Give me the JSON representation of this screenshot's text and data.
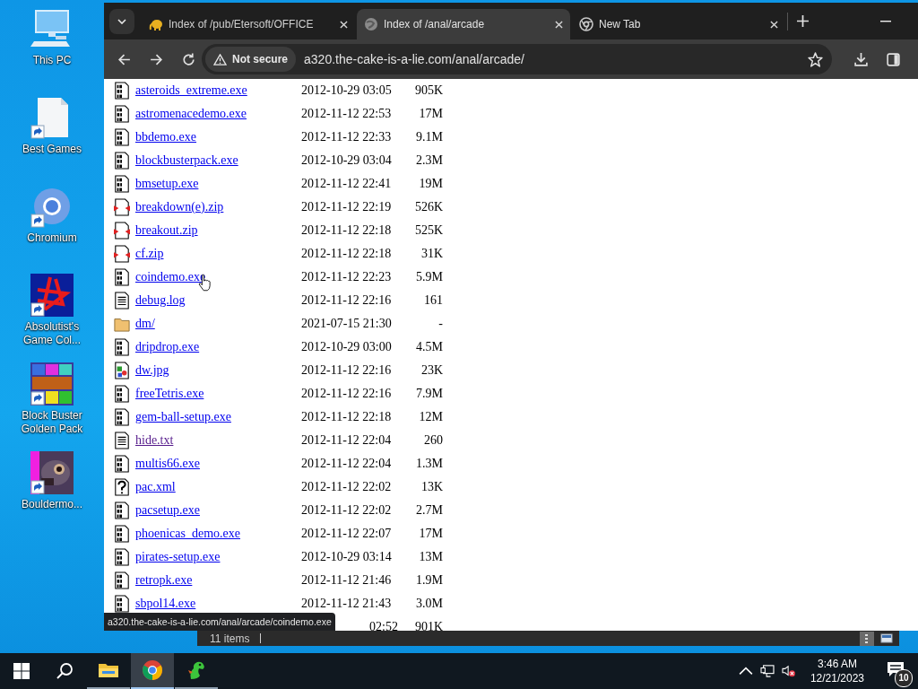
{
  "desktop": {
    "icons": [
      {
        "label": "This PC",
        "kind": "pc",
        "shortcut": false
      },
      {
        "label": "Best Games",
        "kind": "document",
        "shortcut": true
      },
      {
        "label": "Chromium",
        "kind": "chromium",
        "shortcut": true
      },
      {
        "label": "Absolutist's Game Col...",
        "kind": "star",
        "shortcut": true
      },
      {
        "label": "Block Buster Golden Pack",
        "kind": "blocks",
        "shortcut": true
      },
      {
        "label": "Bouldermo...",
        "kind": "creature",
        "shortcut": true
      }
    ]
  },
  "browser": {
    "tabs": [
      {
        "title": "Index of /pub/Etersoft/OFFICE",
        "kind": "elephant",
        "selected": false
      },
      {
        "title": "Index of /anal/arcade",
        "kind": "globe",
        "selected": true
      },
      {
        "title": "New Tab",
        "kind": "chrome",
        "selected": false
      }
    ],
    "address": {
      "security": "Not secure",
      "url": "a320.the-cake-is-a-lie.com/anal/arcade/"
    },
    "listing": {
      "rows": [
        {
          "name": "asteroids_extreme.exe",
          "date": "2012-10-29 03:05",
          "size": "905K",
          "kind": "exe",
          "visited": false,
          "hovered": false
        },
        {
          "name": "astromenacedemo.exe",
          "date": "2012-11-12 22:53",
          "size": "17M",
          "kind": "exe",
          "visited": false,
          "hovered": false
        },
        {
          "name": "bbdemo.exe",
          "date": "2012-11-12 22:33",
          "size": "9.1M",
          "kind": "exe",
          "visited": false,
          "hovered": false
        },
        {
          "name": "blockbusterpack.exe",
          "date": "2012-10-29 03:04",
          "size": "2.3M",
          "kind": "exe",
          "visited": false,
          "hovered": false
        },
        {
          "name": "bmsetup.exe",
          "date": "2012-11-12 22:41",
          "size": "19M",
          "kind": "exe",
          "visited": false,
          "hovered": false
        },
        {
          "name": "breakdown(e).zip",
          "date": "2012-11-12 22:19",
          "size": "526K",
          "kind": "zip",
          "visited": false,
          "hovered": false
        },
        {
          "name": "breakout.zip",
          "date": "2012-11-12 22:18",
          "size": "525K",
          "kind": "zip",
          "visited": false,
          "hovered": false
        },
        {
          "name": "cf.zip",
          "date": "2012-11-12 22:18",
          "size": "31K",
          "kind": "zip",
          "visited": false,
          "hovered": false
        },
        {
          "name": "coindemo.exe",
          "date": "2012-11-12 22:23",
          "size": "5.9M",
          "kind": "exe",
          "visited": false,
          "hovered": true
        },
        {
          "name": "debug.log",
          "date": "2012-11-12 22:16",
          "size": "161",
          "kind": "text",
          "visited": false,
          "hovered": false
        },
        {
          "name": "dm/",
          "date": "2021-07-15 21:30",
          "size": "-",
          "kind": "folder",
          "visited": false,
          "hovered": false
        },
        {
          "name": "dripdrop.exe",
          "date": "2012-10-29 03:00",
          "size": "4.5M",
          "kind": "exe",
          "visited": false,
          "hovered": false
        },
        {
          "name": "dw.jpg",
          "date": "2012-11-12 22:16",
          "size": "23K",
          "kind": "image",
          "visited": false,
          "hovered": false
        },
        {
          "name": "freeTetris.exe",
          "date": "2012-11-12 22:16",
          "size": "7.9M",
          "kind": "exe",
          "visited": false,
          "hovered": false
        },
        {
          "name": "gem-ball-setup.exe",
          "date": "2012-11-12 22:18",
          "size": "12M",
          "kind": "exe",
          "visited": false,
          "hovered": false
        },
        {
          "name": "hide.txt",
          "date": "2012-11-12 22:04",
          "size": "260",
          "kind": "text",
          "visited": true,
          "hovered": false
        },
        {
          "name": "multis66.exe",
          "date": "2012-11-12 22:04",
          "size": "1.3M",
          "kind": "exe",
          "visited": false,
          "hovered": false
        },
        {
          "name": "pac.xml",
          "date": "2012-11-12 22:02",
          "size": "13K",
          "kind": "unknown",
          "visited": false,
          "hovered": false
        },
        {
          "name": "pacsetup.exe",
          "date": "2012-11-12 22:02",
          "size": "2.7M",
          "kind": "exe",
          "visited": false,
          "hovered": false
        },
        {
          "name": "phoenicas_demo.exe",
          "date": "2012-11-12 22:07",
          "size": "17M",
          "kind": "exe",
          "visited": false,
          "hovered": false
        },
        {
          "name": "pirates-setup.exe",
          "date": "2012-10-29 03:14",
          "size": "13M",
          "kind": "exe",
          "visited": false,
          "hovered": false
        },
        {
          "name": "retropk.exe",
          "date": "2012-11-12 21:46",
          "size": "1.9M",
          "kind": "exe",
          "visited": false,
          "hovered": false
        },
        {
          "name": "sbpol14.exe",
          "date": "2012-11-12 21:43",
          "size": "3.0M",
          "kind": "exe",
          "visited": false,
          "hovered": false
        },
        {
          "date": "02:52",
          "size": "901K",
          "kind": "partial"
        }
      ]
    },
    "status_tooltip": "a320.the-cake-is-a-lie.com/anal/arcade/coindemo.exe"
  },
  "explorer_status": {
    "item_count": "11 items"
  },
  "taskbar": {
    "apps": [
      {
        "kind": "explorer",
        "selected": false
      },
      {
        "kind": "chrome",
        "selected": true
      },
      {
        "kind": "dragon",
        "selected": false
      }
    ],
    "clock": {
      "time": "3:46 AM",
      "date": "12/21/2023"
    },
    "notifications": "10"
  }
}
